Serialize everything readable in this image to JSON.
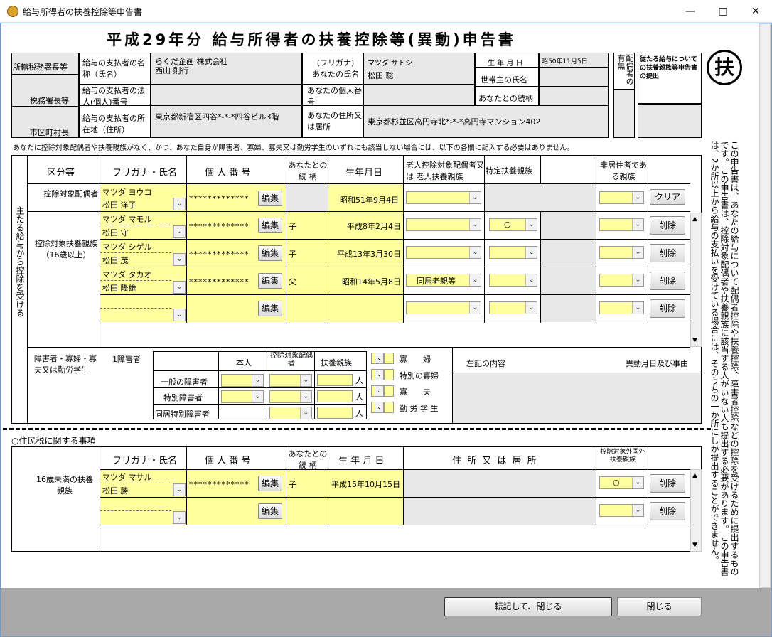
{
  "window": {
    "title": "給与所得者の扶養控除等申告書"
  },
  "form": {
    "title": "平成29年分 給与所得者の扶養控除等(異動)申告書",
    "fu_mark": "扶"
  },
  "header": {
    "office_labels": [
      "所轄税務署長等",
      "税務署長等",
      "市区町村長"
    ],
    "payer_name_label": "給与の支払者の名称（氏名）",
    "payer_name_value": "らくだ企画 株式会社\n西山 則行",
    "payer_corp_no_label": "給与の支払者の法人(個人)番号",
    "payer_corp_no_value": "",
    "payer_address_label": "給与の支払者の所在地（住所）",
    "payer_address_value": "東京都新宿区四谷*-*-*四谷ビル3階",
    "furigana_label": "(フリガナ)\nあなたの氏名",
    "furigana_value": "マツダ サトシ",
    "name_value": "松田 聡",
    "my_number_label": "あなたの個人番号",
    "address_label": "あなたの住所又は居所",
    "address_value": "東京都杉並区高円寺北*-*-*高円寺マンション402",
    "birth_label": "生 年 月 日",
    "birth_value": "昭50年11月5日",
    "head_name_label": "世帯主の氏名",
    "relation_label": "あなたとの続柄",
    "spouse_label": "配偶者の有無",
    "main_payer_label": "従たる給与についての扶養親族等申告書の提出"
  },
  "notice": "あなたに控除対象配偶者や扶養親族がなく、かつ、あなた自身が障害者、寡婦、寡夫又は勤労学生のいずれにも該当しない場合には、以下の各欄に記入する必要はありません。",
  "main_section": {
    "side_label": "主たる給与から控除を受ける",
    "columns": [
      "区分等",
      "フリガナ・氏名",
      "個 人 番 号",
      "あなたとの続 柄",
      "生年月日",
      "老人控除対象配偶者又は 老人扶養親族",
      "特定扶養親族",
      "",
      "非居住者である親族",
      ""
    ],
    "spouse_row": {
      "category": "控除対象配偶者",
      "kana": "マツダ ヨウコ",
      "name": "松田 洋子",
      "number": "*************",
      "edit": "編集",
      "relation": "",
      "birth": "昭和51年9月4日",
      "button": "クリア"
    },
    "dependents_category": "控除対象扶養親族（16歳以上）",
    "dependents": [
      {
        "kana": "マツダ マモル",
        "name": "松田 守",
        "number": "*************",
        "edit": "編集",
        "relation": "子",
        "birth": "平成8年2月4日",
        "elderly": "",
        "specific": "○",
        "nonres": "",
        "button": "削除"
      },
      {
        "kana": "マツダ シゲル",
        "name": "松田 茂",
        "number": "*************",
        "edit": "編集",
        "relation": "子",
        "birth": "平成13年3月30日",
        "elderly": "",
        "specific": "",
        "nonres": "",
        "button": "削除"
      },
      {
        "kana": "マツダ タカオ",
        "name": "松田 隆雄",
        "number": "*************",
        "edit": "編集",
        "relation": "父",
        "birth": "昭和14年5月8日",
        "elderly": "同居老親等",
        "specific": "",
        "nonres": "",
        "button": "削除"
      },
      {
        "kana": "",
        "name": "",
        "number": "",
        "edit": "編集",
        "relation": "",
        "birth": "",
        "elderly": "",
        "specific": "",
        "nonres": "",
        "button": "削除"
      }
    ],
    "disability": {
      "category": "障害者・寡婦・寡夫又は勤労学生",
      "sub_label": "1障害者",
      "cols": [
        "本人",
        "控除対象配偶者",
        "扶養親族"
      ],
      "rows": [
        "一般の障害者",
        "特別障害者",
        "同居特別障害者"
      ],
      "unit": "人",
      "checks": [
        "寡　　婦",
        "特別の寡婦",
        "寡　　夫",
        "勤 労 学 生"
      ],
      "content_label": "左記の内容",
      "change_label": "異動月日及び事由"
    }
  },
  "resident_section": {
    "title": "○住民税に関する事項",
    "columns": [
      "フリガナ・氏名",
      "個 人 番 号",
      "あなたとの続 柄",
      "生 年 月 日",
      "住 所 又 は 居 所",
      "控除対象外国外扶養親族"
    ],
    "category": "16歳未満の扶養親族",
    "rows": [
      {
        "kana": "マツダ マサル",
        "name": "松田 勝",
        "number": "*************",
        "edit": "編集",
        "relation": "子",
        "birth": "平成15年10月15日",
        "flag": "○",
        "button": "削除"
      },
      {
        "kana": "",
        "name": "",
        "number": "",
        "edit": "編集",
        "relation": "",
        "birth": "",
        "flag": "",
        "button": "削除"
      }
    ]
  },
  "side_note": "この申告書は、あなたの給与について配偶者控除や扶養控除、障害者控除などの控除を受けるために提出するものです。この申告書は、控除対象配偶者や扶養親族に該当する人がいない人も提出する必要があります。この申告書は、2か所以上から給与の支払いを受けている場合には、そのうちの一か所にしか提出することができません。",
  "footer": {
    "transcribe_button": "転記して、閉じる",
    "close_button": "閉じる"
  }
}
